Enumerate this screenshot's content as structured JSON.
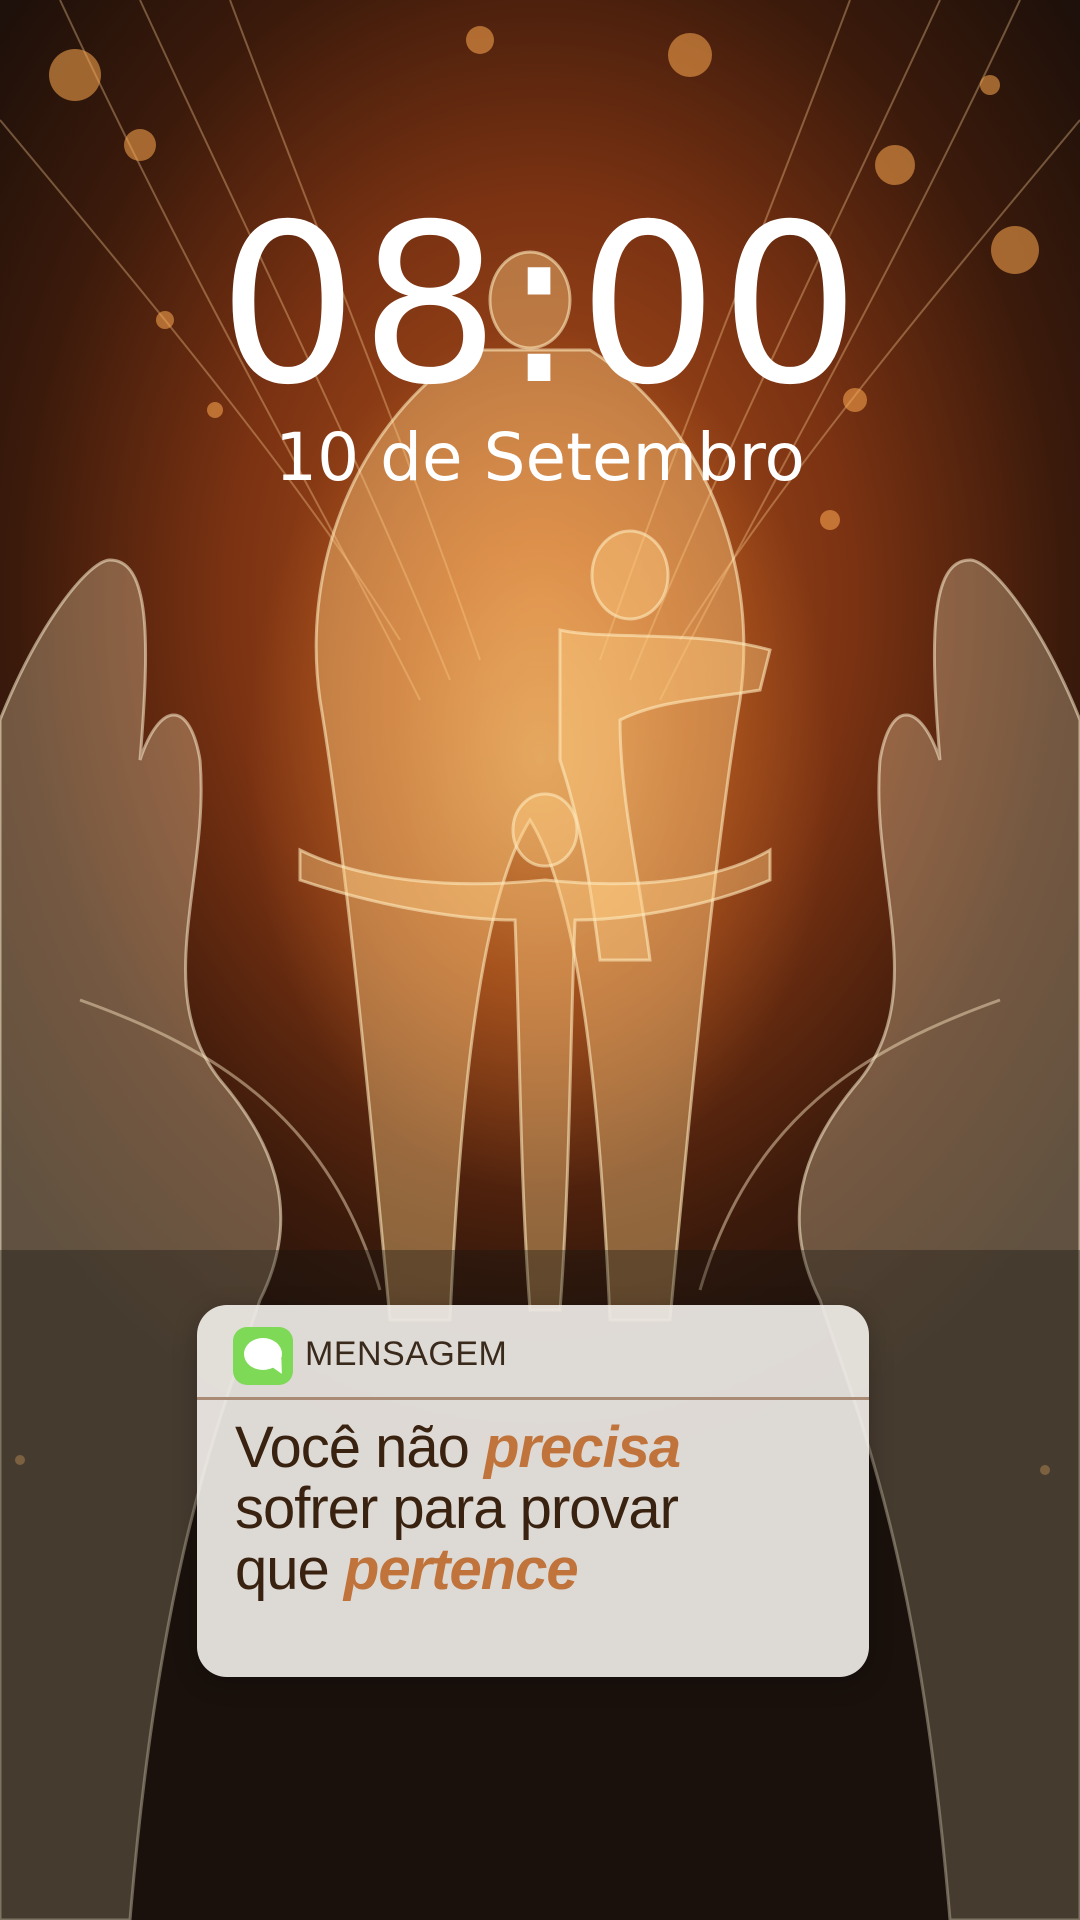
{
  "lockscreen": {
    "time": "08:00",
    "date": "10 de Setembro"
  },
  "notification": {
    "app_icon": "message-bubble-icon",
    "app_name": "MENSAGEM",
    "line1_plain": "Você não ",
    "line1_accent": "precisa",
    "line2": "sofrer para provar",
    "line3_plain": "que ",
    "line3_accent": "pertence"
  },
  "colors": {
    "text_white": "#ffffff",
    "notification_bg": "#f3f0eb",
    "body_text": "#3a2210",
    "accent": "#c0733a",
    "app_icon_green": "#7ed957"
  }
}
